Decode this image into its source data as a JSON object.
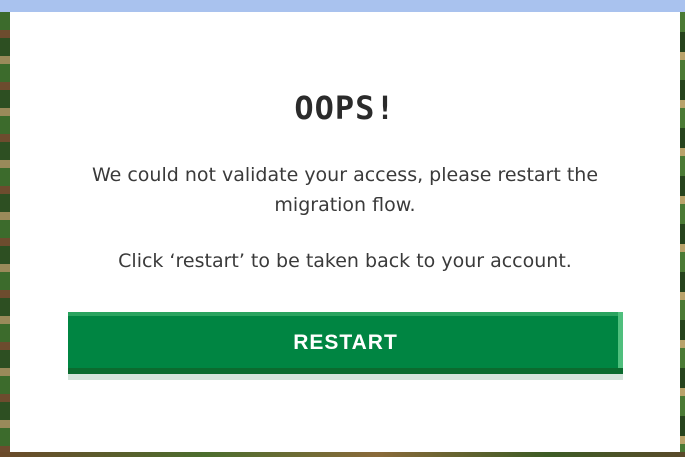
{
  "dialog": {
    "title": "OOPS!",
    "message_line1": "We could not validate your access, please restart the migration flow.",
    "message_line2": "Click ‘restart’ to be taken back to your account.",
    "restart_button_label": "RESTART"
  },
  "colors": {
    "button_green": "#008542",
    "title_text": "#2b2b2b",
    "body_text": "#3a3a3a",
    "dialog_background": "#ffffff"
  }
}
